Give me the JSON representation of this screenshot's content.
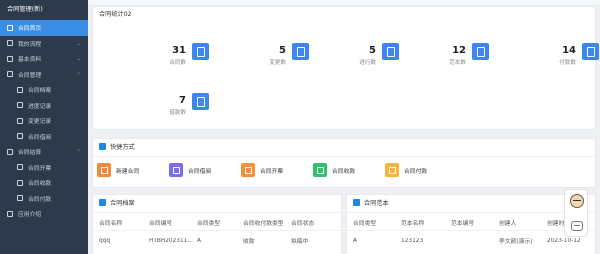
{
  "sidebar": {
    "title": "合同管理(新)",
    "items": [
      {
        "label": "合同首页",
        "sub": false,
        "active": true,
        "arrow": ""
      },
      {
        "label": "我的流程",
        "sub": false,
        "active": false,
        "arrow": "⌄"
      },
      {
        "label": "基本资料",
        "sub": false,
        "active": false,
        "arrow": "⌄"
      },
      {
        "label": "合同管理",
        "sub": false,
        "active": false,
        "arrow": "⌃"
      },
      {
        "label": "合同档案",
        "sub": true,
        "active": false,
        "arrow": ""
      },
      {
        "label": "进度记录",
        "sub": true,
        "active": false,
        "arrow": ""
      },
      {
        "label": "变更记录",
        "sub": true,
        "active": false,
        "arrow": ""
      },
      {
        "label": "合同借阅",
        "sub": true,
        "active": false,
        "arrow": ""
      },
      {
        "label": "合同结算",
        "sub": false,
        "active": false,
        "arrow": "⌃"
      },
      {
        "label": "合同开票",
        "sub": true,
        "active": false,
        "arrow": ""
      },
      {
        "label": "合同收款",
        "sub": true,
        "active": false,
        "arrow": ""
      },
      {
        "label": "合同付款",
        "sub": true,
        "active": false,
        "arrow": ""
      },
      {
        "label": "应用介绍",
        "sub": false,
        "active": false,
        "arrow": ""
      }
    ]
  },
  "stats_card": {
    "title": "合同统计02",
    "stats": [
      {
        "value": "31",
        "label": "合同数"
      },
      {
        "value": "5",
        "label": "变更数"
      },
      {
        "value": "5",
        "label": "进行数"
      },
      {
        "value": "12",
        "label": "范本数"
      },
      {
        "value": "14",
        "label": "付款数"
      },
      {
        "value": "7",
        "label": "借款数"
      }
    ]
  },
  "quick_card": {
    "title": "快捷方式",
    "actions": [
      {
        "label": "新建合同",
        "color": "#f08a3c"
      },
      {
        "label": "合同借阅",
        "color": "#7b6ee6"
      },
      {
        "label": "合同开票",
        "color": "#f5903a"
      },
      {
        "label": "合同收款",
        "color": "#34c06a"
      },
      {
        "label": "合同付款",
        "color": "#f6b43a"
      }
    ]
  },
  "archive_card": {
    "title": "合同档案",
    "columns": [
      "合同名称",
      "合同编号",
      "合同类型",
      "合同收付款类型",
      "合同状态"
    ],
    "rows": [
      [
        "qqq",
        "HTBH202311...",
        "A",
        "收款",
        "拟稿中"
      ]
    ]
  },
  "template_card": {
    "title": "合同范本",
    "columns": [
      "合同类型",
      "范本名称",
      "范本编号",
      "创建人",
      "创建时间"
    ],
    "rows": [
      [
        "A",
        "123123",
        "",
        "李文颜(演示)",
        "2023-10-12"
      ]
    ]
  },
  "colors": {
    "accent": "#3a8ee6",
    "sidebar_bg": "#2d3a4b",
    "stat_icon": "#3d86f0"
  }
}
